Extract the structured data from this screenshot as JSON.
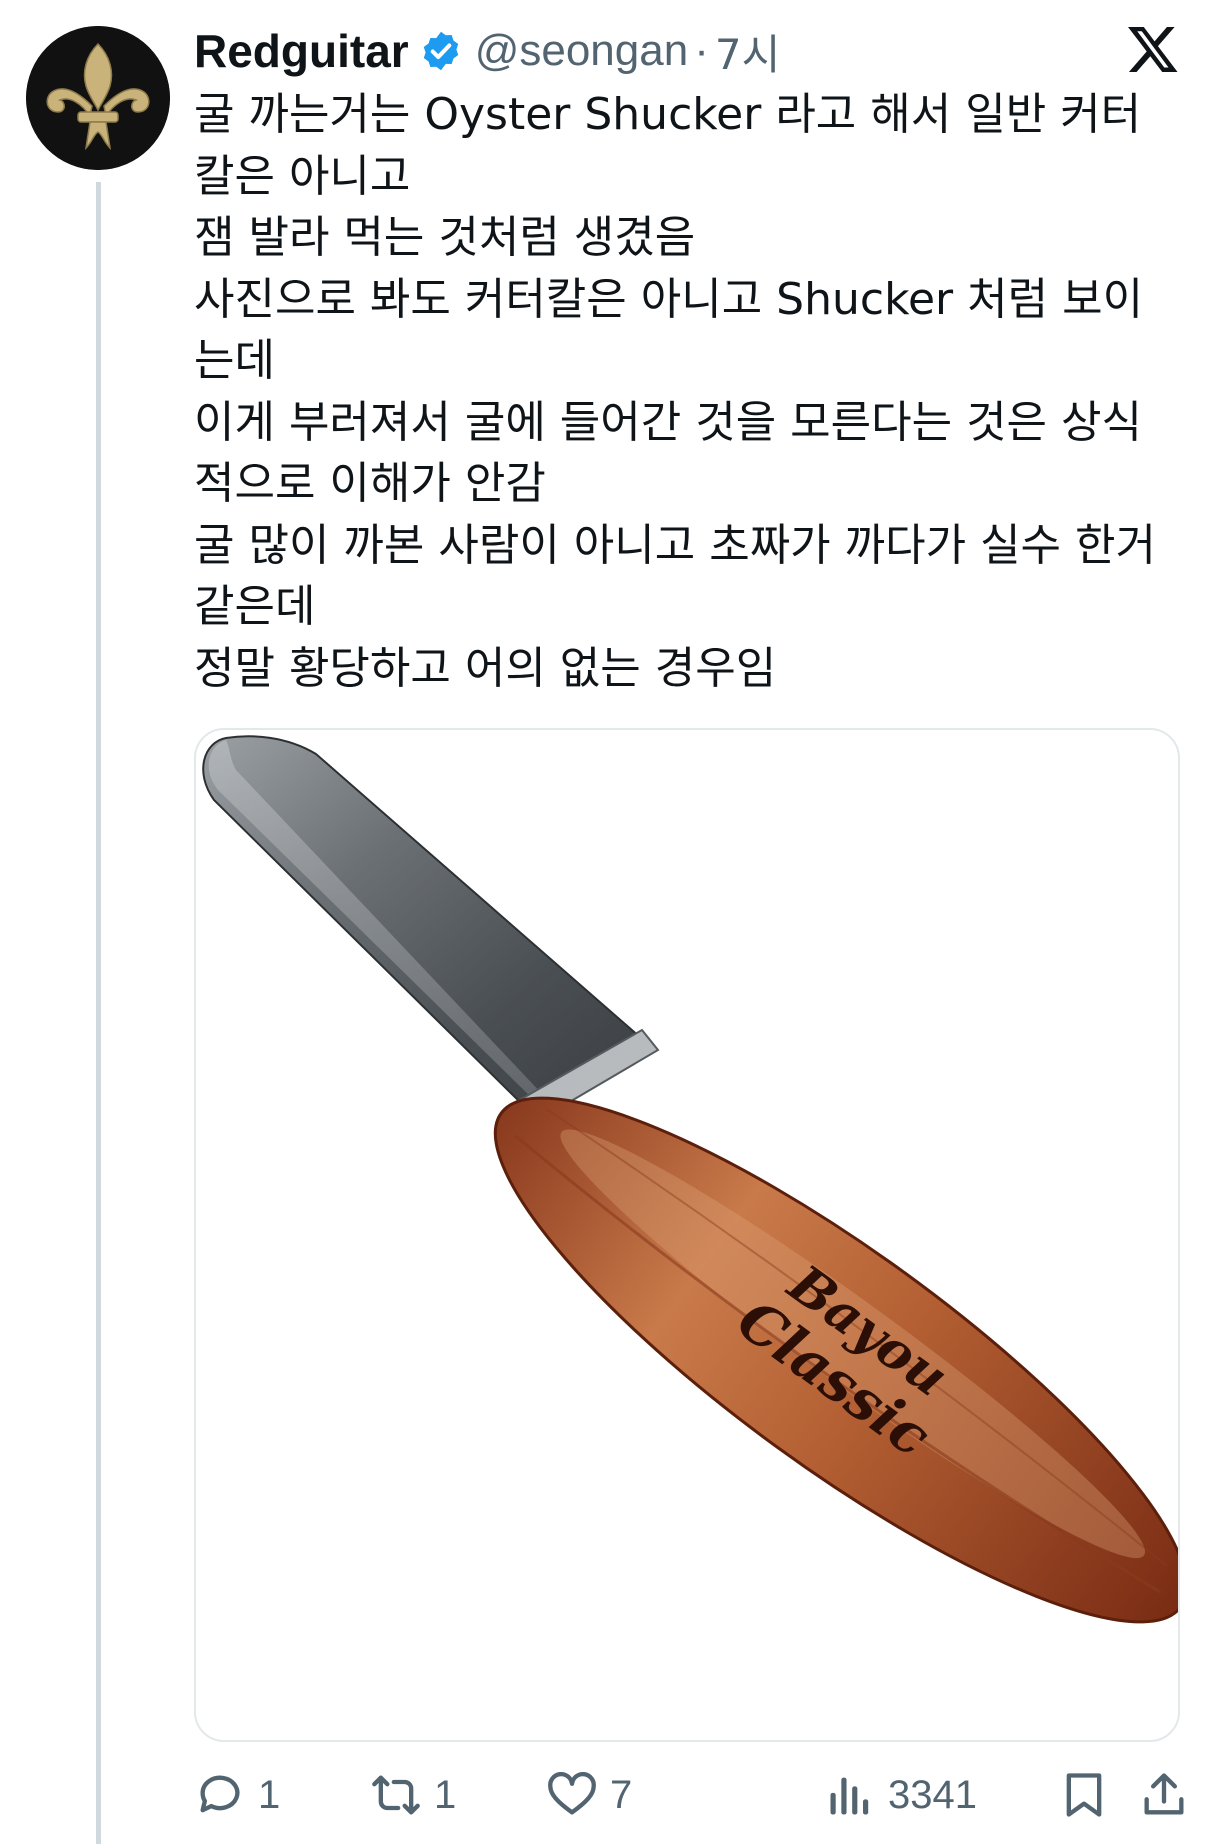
{
  "author": {
    "display_name": "Redguitar",
    "handle": "@seongan",
    "separator": "·",
    "time": "7시"
  },
  "tweet": {
    "lines": [
      "굴 까는거는 Oyster Shucker 라고 해서 일반 커터",
      "칼은 아니고",
      "잼 발라 먹는 것처럼 생겼음",
      "사진으로 봐도 커터칼은 아니고 Shucker 처럼 보이",
      "는데",
      "이게 부러져서 굴에 들어간 것을 모른다는 것은 상식",
      "적으로 이해가 안감",
      "굴 많이 까본 사람이 아니고 초짜가 까다가 실수 한거",
      "같은데",
      "정말 황당하고 어의 없는 경우임"
    ]
  },
  "media": {
    "handle_brand_top": "Bayou",
    "handle_brand_bottom": "Classic"
  },
  "actions": {
    "reply_count": "1",
    "repost_count": "1",
    "like_count": "7",
    "views_count": "3341"
  },
  "icons": {
    "avatar": "fleur-de-lis-icon",
    "verified": "verified-badge-icon",
    "platform": "x-logo-icon",
    "reply": "reply-icon",
    "repost": "repost-icon",
    "like": "heart-icon",
    "views": "views-icon",
    "bookmark": "bookmark-icon",
    "share": "share-icon"
  },
  "colors": {
    "verified_blue": "#1d9bf0",
    "text_primary": "#0f1419",
    "text_secondary": "#536471",
    "avatar_gold": "#c9b37a"
  }
}
